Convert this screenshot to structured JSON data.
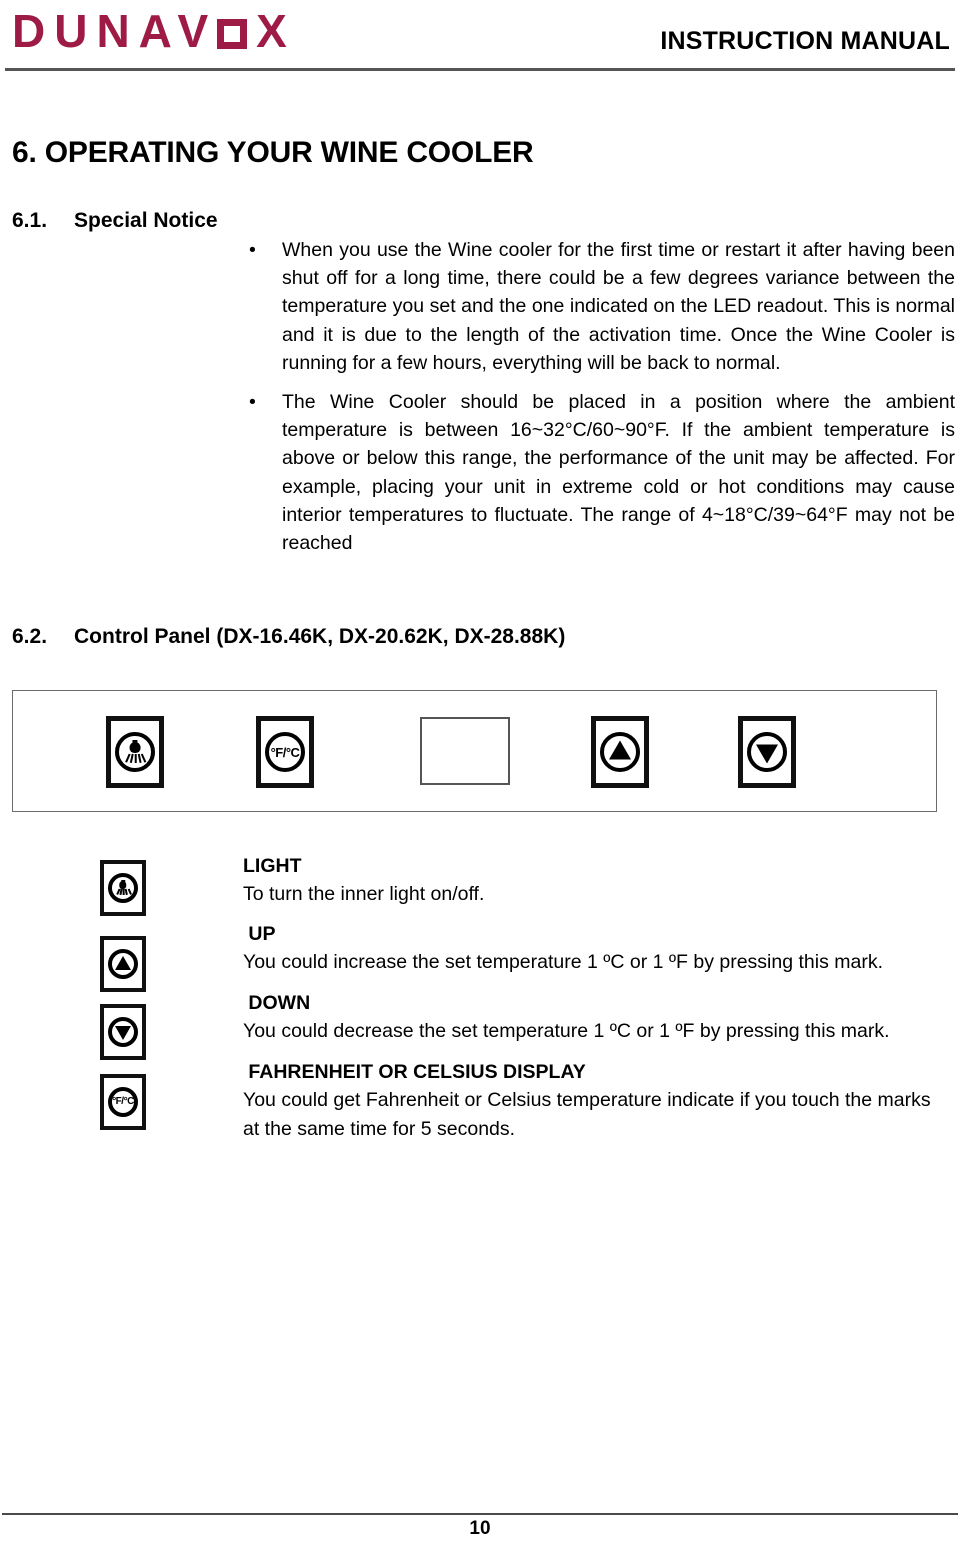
{
  "header": {
    "logo_text": "DUNAV",
    "logo_text_tail": "X",
    "logo_o_icon": "square-o-glyph",
    "title": "INSTRUCTION MANUAL",
    "brand_color": "#9e1b45"
  },
  "headings": {
    "main": "6. OPERATING YOUR WINE COOLER",
    "sec_61_num": "6.1.",
    "sec_61_title": "Special Notice",
    "sec_62_num": "6.2.",
    "sec_62_title": "Control Panel (DX-16.46K, DX-20.62K, DX-28.88K)"
  },
  "notices": {
    "bullet_glyph": "•",
    "items": [
      "When you use the Wine cooler for the first time or restart it after having been shut off for a long time, there could be a few degrees variance between the temperature you set and the one indicated on the LED readout. This is normal and it is due to the length of the activation time. Once the Wine Cooler is running for a few hours, everything will be back to normal.",
      "The Wine Cooler should be placed in a position where the ambient temperature is between 16~32°C/60~90°F. If the ambient temperature is above or below this range, the performance of the unit may be affected. For example, placing your unit in extreme cold or hot conditions may cause interior temperatures to fluctuate. The range of 4~18°C/39~64°F may not be reached"
    ]
  },
  "control_panel": {
    "buttons": [
      {
        "icon": "light-bulb-icon",
        "name": "light-button"
      },
      {
        "icon": "fahrenheit-celsius-icon",
        "name": "fahrenheit-celsius-button",
        "label": "°F/°C"
      },
      {
        "icon": "display-screen",
        "name": "led-display"
      },
      {
        "icon": "up-arrow-icon",
        "name": "up-button"
      },
      {
        "icon": "down-arrow-icon",
        "name": "down-button"
      }
    ],
    "fc_label": "°F/°C"
  },
  "legend": {
    "rows": [
      {
        "icon": "light-bulb-icon",
        "title": "LIGHT",
        "desc": "To turn the inner light on/off."
      },
      {
        "icon": "up-arrow-icon",
        "title": " UP",
        "desc": "You could increase the set temperature 1 ºC or 1 ºF by pressing this mark."
      },
      {
        "icon": "down-arrow-icon",
        "title": " DOWN",
        "desc": "You could decrease the set temperature 1 ºC or 1 ºF by pressing this mark."
      },
      {
        "icon": "fahrenheit-celsius-icon",
        "title": " FAHRENHEIT OR CELSIUS DISPLAY",
        "desc": "You could get Fahrenheit or Celsius temperature indicate if you touch the marks at the same time for 5 seconds."
      }
    ]
  },
  "footer": {
    "page_number": "10"
  }
}
